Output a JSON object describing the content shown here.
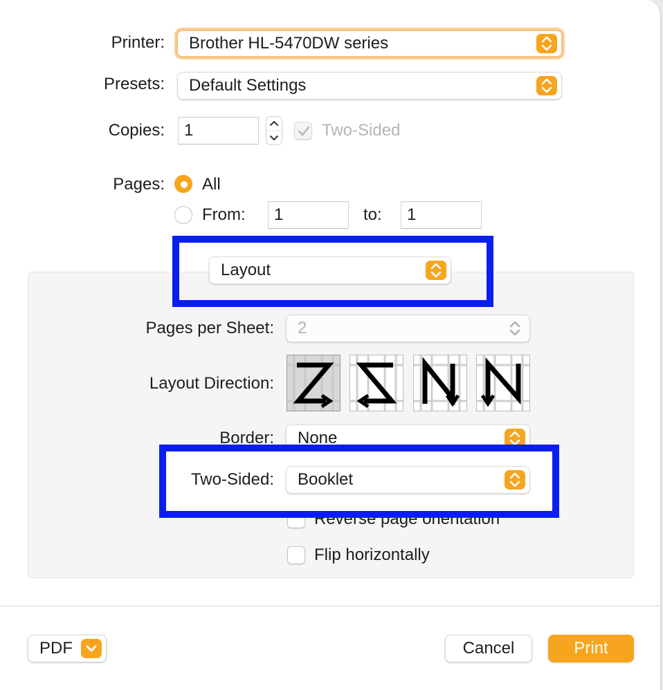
{
  "printer": {
    "label": "Printer:",
    "value": "Brother HL-5470DW series"
  },
  "presets": {
    "label": "Presets:",
    "value": "Default Settings"
  },
  "copies": {
    "label": "Copies:",
    "value": "1",
    "two_sided_label": "Two-Sided"
  },
  "pages": {
    "label": "Pages:",
    "all_label": "All",
    "from_label": "From:",
    "from_value": "1",
    "to_label": "to:",
    "to_value": "1"
  },
  "section_menu": {
    "value": "Layout"
  },
  "layout": {
    "pages_per_sheet_label": "Pages per Sheet:",
    "pages_per_sheet_value": "2",
    "layout_direction_label": "Layout Direction:",
    "border_label": "Border:",
    "border_value": "None",
    "two_sided_label": "Two-Sided:",
    "two_sided_value": "Booklet",
    "reverse_label": "Reverse page orientation",
    "flip_label": "Flip horizontally"
  },
  "footer": {
    "pdf_label": "PDF",
    "cancel_label": "Cancel",
    "print_label": "Print"
  },
  "colors": {
    "accent": "#f7a51e",
    "highlight": "#0a1ef0"
  }
}
